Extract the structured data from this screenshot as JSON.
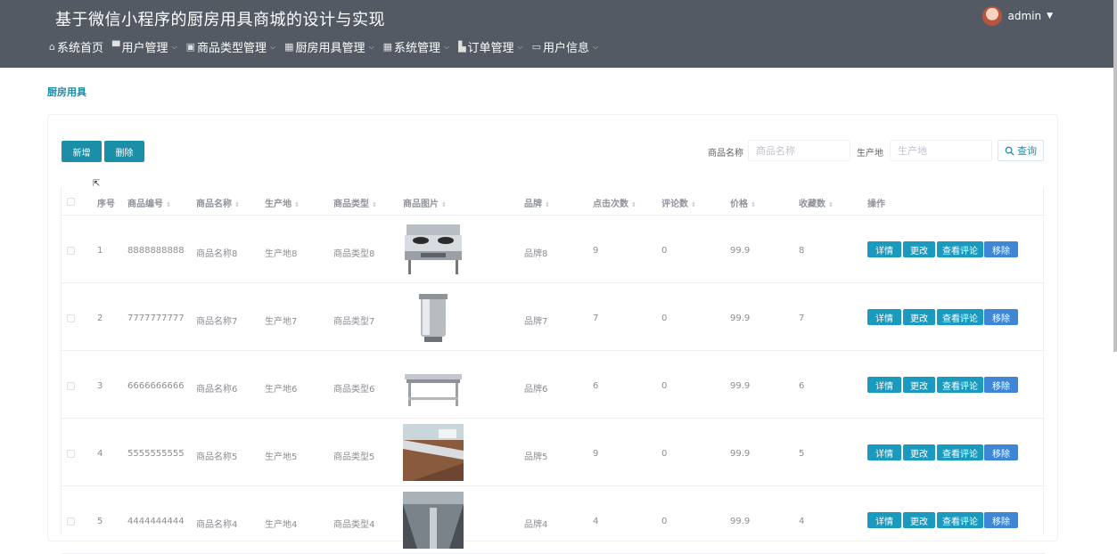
{
  "header": {
    "title": "基于微信小程序的厨房用具商城的设计与实现",
    "user": "admin"
  },
  "nav": [
    {
      "label": "系统首页",
      "icon": "home-icon",
      "glyph": "⌂",
      "has_dropdown": false
    },
    {
      "label": "用户管理",
      "icon": "user-manage-icon",
      "glyph": "▀",
      "has_dropdown": true
    },
    {
      "label": "商品类型管理",
      "icon": "picture-icon",
      "glyph": "▣",
      "has_dropdown": true
    },
    {
      "label": "厨房用具管理",
      "icon": "grid-icon",
      "glyph": "▦",
      "has_dropdown": true
    },
    {
      "label": "系统管理",
      "icon": "grid-icon",
      "glyph": "▦",
      "has_dropdown": true
    },
    {
      "label": "订单管理",
      "icon": "cart-icon",
      "glyph": "▙",
      "has_dropdown": true
    },
    {
      "label": "用户信息",
      "icon": "card-icon",
      "glyph": "▭",
      "has_dropdown": true
    }
  ],
  "breadcrumb": "厨房用具",
  "toolbar": {
    "add_label": "新增",
    "delete_label": "删除",
    "search_name_label": "商品名称",
    "search_name_placeholder": "商品名称",
    "search_origin_label": "生产地",
    "search_origin_placeholder": "生产地",
    "query_label": "查询"
  },
  "table": {
    "columns": [
      "序号",
      "商品编号",
      "商品名称",
      "生产地",
      "商品类型",
      "商品图片",
      "品牌",
      "点击次数",
      "评论数",
      "价格",
      "收藏数",
      "操作"
    ],
    "action_labels": [
      "详情",
      "更改",
      "查看评论",
      "移除"
    ],
    "rows": [
      {
        "index": "1",
        "code": "8888888888",
        "name": "商品名称8",
        "origin": "生产地8",
        "type": "商品类型8",
        "image": "stove",
        "brand": "品牌8",
        "clicks": "9",
        "comments": "0",
        "price": "99.9",
        "favorites": "8"
      },
      {
        "index": "2",
        "code": "7777777777",
        "name": "商品名称7",
        "origin": "生产地7",
        "type": "商品类型7",
        "image": "bucket",
        "brand": "品牌7",
        "clicks": "7",
        "comments": "0",
        "price": "99.9",
        "favorites": "7"
      },
      {
        "index": "3",
        "code": "6666666666",
        "name": "商品名称6",
        "origin": "生产地6",
        "type": "商品类型6",
        "image": "table",
        "brand": "品牌6",
        "clicks": "6",
        "comments": "0",
        "price": "99.9",
        "favorites": "6"
      },
      {
        "index": "4",
        "code": "5555555555",
        "name": "商品名称5",
        "origin": "生产地5",
        "type": "商品类型5",
        "image": "kitchen",
        "brand": "品牌5",
        "clicks": "9",
        "comments": "0",
        "price": "99.9",
        "favorites": "5"
      },
      {
        "index": "5",
        "code": "4444444444",
        "name": "商品名称4",
        "origin": "生产地4",
        "type": "商品类型4",
        "image": "kitchen2",
        "brand": "品牌4",
        "clicks": "4",
        "comments": "0",
        "price": "99.9",
        "favorites": "4"
      }
    ]
  },
  "colors": {
    "header_bg": "#535a64",
    "primary": "#1b8ea8",
    "action_blue": "#1b9ac0",
    "remove_blue": "#3f86d4"
  }
}
